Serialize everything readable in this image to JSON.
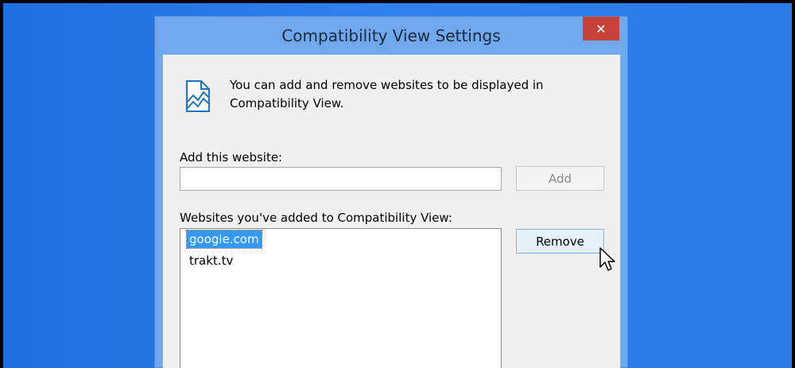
{
  "window": {
    "title": "Compatibility View Settings",
    "close_symbol": "✕"
  },
  "info": {
    "icon": "compatibility-page-icon",
    "text": "You can add and remove websites to be displayed in Compatibility View."
  },
  "add_section": {
    "label": "Add this website:",
    "input_value": "",
    "button_label": "Add"
  },
  "list_section": {
    "label": "Websites you've added to Compatibility View:",
    "items": [
      {
        "label": "google.com",
        "selected": true
      },
      {
        "label": "trakt.tv",
        "selected": false
      }
    ],
    "remove_label": "Remove"
  },
  "colors": {
    "desktop": "#2a7ae6",
    "window_frame": "#6fa8ec",
    "close_button": "#c7413a",
    "selection": "#3399ff"
  }
}
